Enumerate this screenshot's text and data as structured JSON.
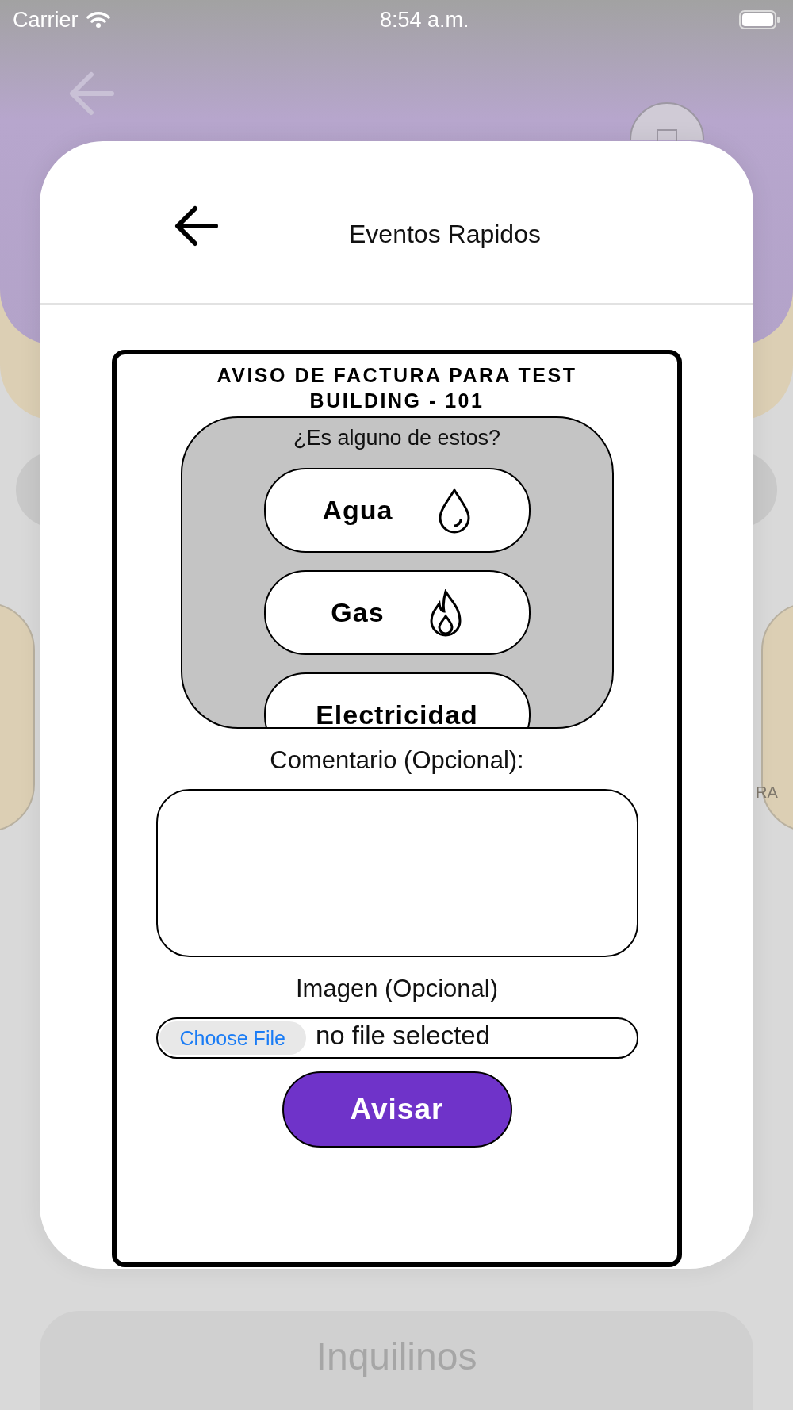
{
  "status_bar": {
    "carrier": "Carrier",
    "time": "8:54 a.m."
  },
  "background": {
    "side_label": "RA",
    "bottom_card": "Inquilinos"
  },
  "modal": {
    "title": "Eventos Rapidos",
    "form": {
      "title": "AVISO DE FACTURA PARA TEST BUILDING - 101",
      "question": "¿Es alguno de estos?",
      "options": [
        {
          "label": "Agua",
          "kind": "water"
        },
        {
          "label": "Gas",
          "kind": "gas"
        },
        {
          "label": "Electricidad",
          "kind": "electric"
        }
      ],
      "comment_label": "Comentario (Opcional):",
      "image_label": "Imagen (Opcional)",
      "file_button": "Choose File",
      "file_status": "no file selected",
      "submit": "Avisar"
    }
  }
}
